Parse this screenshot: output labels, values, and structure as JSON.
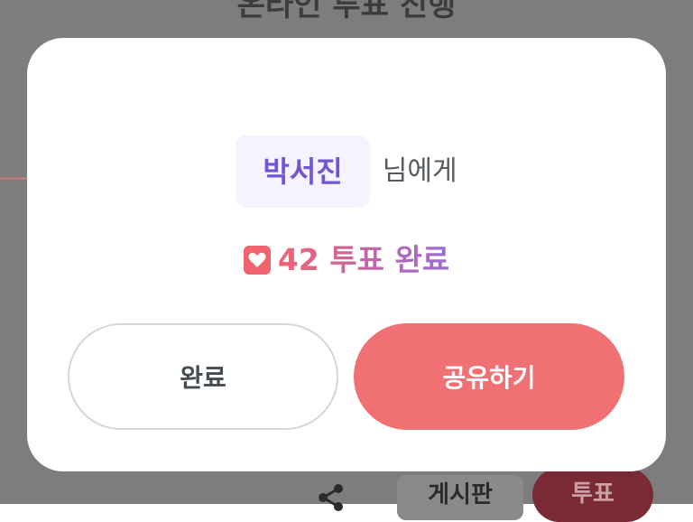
{
  "background": {
    "title": "온라인 투표 진행",
    "bottom_bar": {
      "share_icon": "share-icon",
      "board_label": "게시판",
      "vote_label": "투표"
    }
  },
  "modal": {
    "recipient_name": "박서진",
    "recipient_suffix": "님에게",
    "heart_icon": "heart-icon",
    "vote_result": "42 투표 완료",
    "done_button": "완료",
    "share_button": "공유하기"
  },
  "colors": {
    "accent_purple": "#7454d6",
    "accent_red": "#f07073",
    "heart_red": "#f0646e"
  }
}
